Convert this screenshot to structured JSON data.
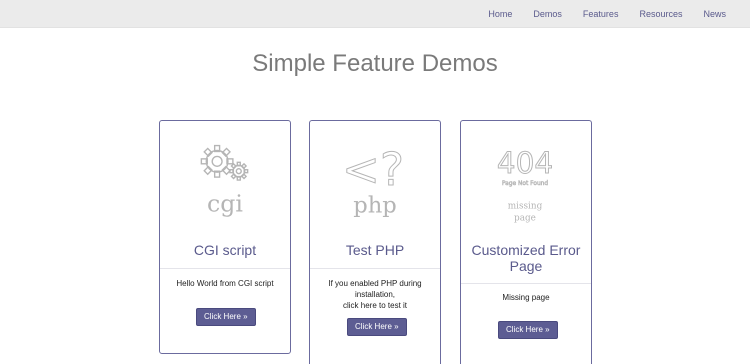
{
  "nav": {
    "links": [
      "Home",
      "Demos",
      "Features",
      "Resources",
      "News"
    ]
  },
  "page": {
    "title": "Simple Feature Demos"
  },
  "cards": [
    {
      "icon": "gears-icon",
      "icon_text": "cgi",
      "title": "CGI script",
      "text_lines": [
        "Hello World from CGI script"
      ],
      "button": "Click Here »"
    },
    {
      "icon": "php-icon",
      "icon_symbol": "<?",
      "icon_text": "php",
      "title": "Test PHP",
      "text_lines": [
        "If you enabled PHP during",
        "installation,",
        "click here to test it"
      ],
      "button": "Click Here »"
    },
    {
      "icon": "not-found-icon",
      "icon_code": "404",
      "icon_caption": "Page Not Found",
      "icon_text_lines": [
        "missing",
        "page"
      ],
      "title_lines": [
        "Customized Error",
        "Page"
      ],
      "text_lines": [
        "Missing page"
      ],
      "button": "Click Here »"
    }
  ],
  "colors": {
    "accent": "#5a5a8c",
    "button": "#5d5d93",
    "navbar": "#ebebeb",
    "icon": "#b5b5b5"
  }
}
